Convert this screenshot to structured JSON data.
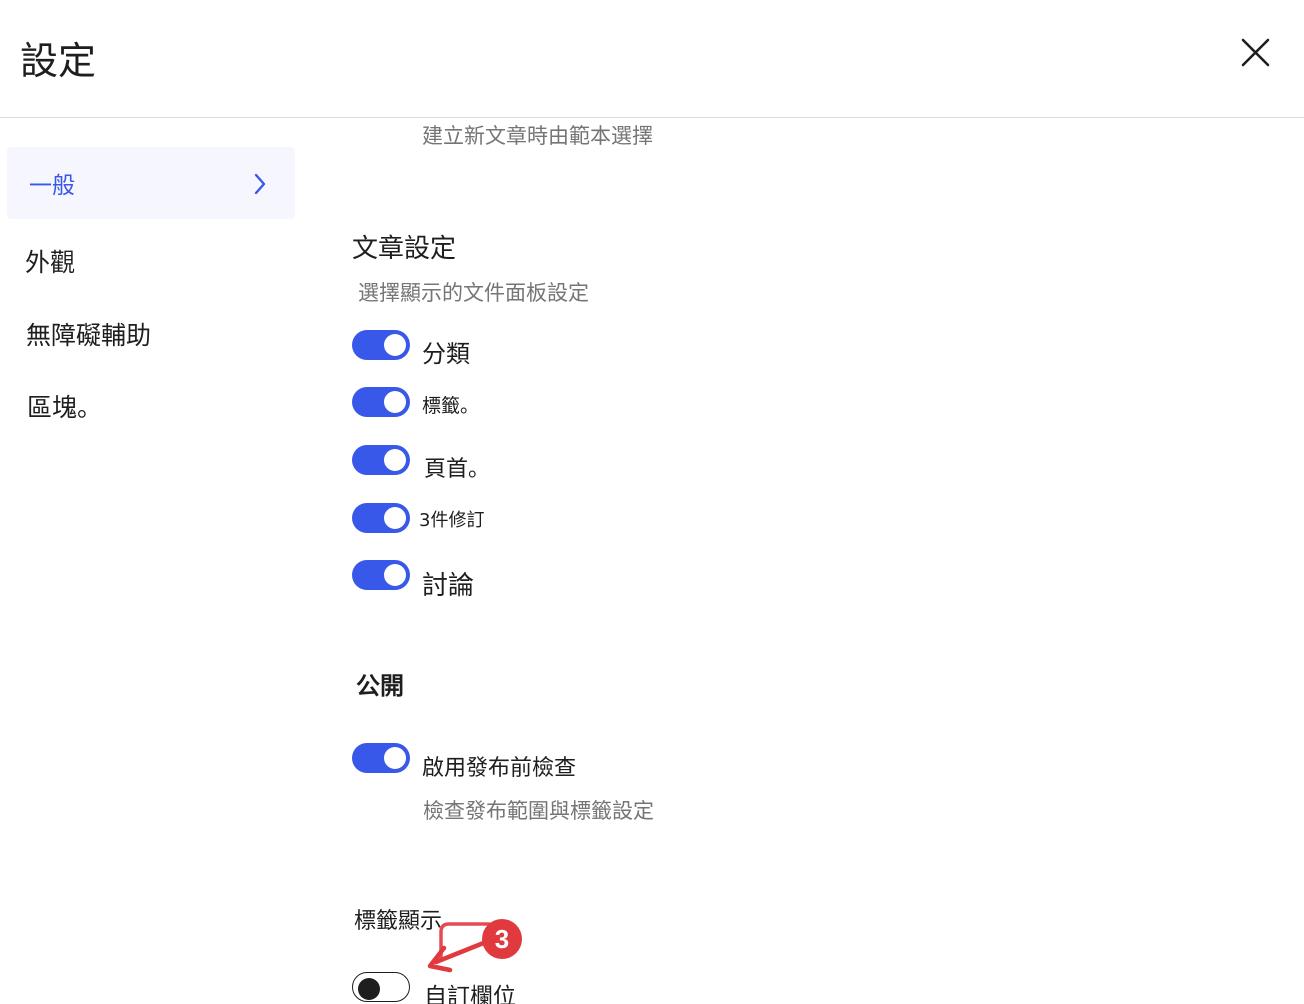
{
  "modal": {
    "title": "設定",
    "close_icon": "close-icon"
  },
  "sidebar": {
    "items": [
      {
        "label": "一般",
        "active": true
      },
      {
        "label": "外觀",
        "active": false
      },
      {
        "label": "無障礙輔助",
        "active": false
      },
      {
        "label": "區塊。",
        "active": false
      }
    ]
  },
  "content": {
    "templates_help": "建立新文章時由範本選擇",
    "post_settings": {
      "heading": "文章設定",
      "help": "選擇顯示的文件面板設定",
      "toggles": [
        {
          "label": "分類",
          "checked": true
        },
        {
          "label": "標籤。",
          "checked": true
        },
        {
          "label": "頁首。",
          "checked": true
        },
        {
          "label": "3件修訂",
          "checked": true
        },
        {
          "label": "討論",
          "checked": true
        }
      ]
    },
    "publish": {
      "heading": "公開",
      "toggle_label": "啟用發布前檢查",
      "checked": true,
      "help": "檢查發布範圍與標籤設定"
    },
    "tag_display": {
      "heading": "標籤顯示",
      "toggle_label": "自訂欄位",
      "checked": false
    }
  },
  "annotation": {
    "badge_number": "3",
    "color": "#e0393e"
  },
  "colors": {
    "accent": "#3858e9",
    "text": "#1e1e1e",
    "muted": "#757575",
    "sidebar_active_bg": "#f6f6fe"
  }
}
